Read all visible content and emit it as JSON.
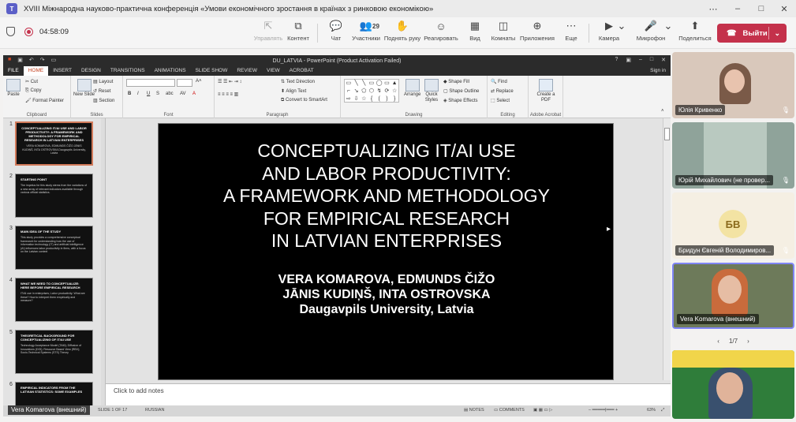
{
  "window": {
    "title": "XVIII Міжнародна науково-практична конференція «Умови економічного зростання в країнах з ринковою економікою»",
    "app_icon": "T"
  },
  "toolbar": {
    "elapsed": "04:58:09",
    "items": [
      {
        "id": "control",
        "label": "Управлять",
        "icon": "⇱",
        "disabled": true
      },
      {
        "id": "content",
        "label": "Контент",
        "icon": "⧉",
        "disabled": false
      },
      {
        "id": "chat",
        "label": "Чат",
        "icon": "💬",
        "disabled": false
      },
      {
        "id": "people",
        "label": "Участники",
        "icon": "👥",
        "disabled": false,
        "count": "29"
      },
      {
        "id": "raise",
        "label": "Поднять руку",
        "icon": "✋",
        "disabled": false
      },
      {
        "id": "react",
        "label": "Реагировать",
        "icon": "☺",
        "disabled": false
      },
      {
        "id": "view",
        "label": "Вид",
        "icon": "▦",
        "disabled": false
      },
      {
        "id": "rooms",
        "label": "Комнаты",
        "icon": "◫",
        "disabled": false
      },
      {
        "id": "apps",
        "label": "Приложения",
        "icon": "⊕",
        "disabled": false
      },
      {
        "id": "more",
        "label": "Еще",
        "icon": "⋯",
        "disabled": false
      },
      {
        "id": "camera",
        "label": "Камера",
        "icon": "▶",
        "disabled": false
      },
      {
        "id": "mic",
        "label": "Микрофон",
        "icon": "🎤",
        "disabled": false
      },
      {
        "id": "share",
        "label": "Поделиться",
        "icon": "⬆",
        "disabled": false
      }
    ],
    "leave_label": "Выйти",
    "colors": {
      "leave": "#c4314b"
    }
  },
  "powerpoint": {
    "title": "DU_LATVIA - PowerPoint (Product Activation Failed)",
    "sign_in": "Sign in",
    "tabs": [
      "FILE",
      "HOME",
      "INSERT",
      "DESIGN",
      "TRANSITIONS",
      "ANIMATIONS",
      "SLIDE SHOW",
      "REVIEW",
      "VIEW",
      "ACROBAT"
    ],
    "ribbon": {
      "clipboard": {
        "paste": "Paste",
        "cut": "Cut",
        "copy": "Copy",
        "format_painter": "Format Painter",
        "label": "Clipboard"
      },
      "slides": {
        "new_slide": "New Slide",
        "layout": "Layout",
        "reset": "Reset",
        "section": "Section",
        "label": "Slides"
      },
      "font": {
        "label": "Font"
      },
      "paragraph": {
        "text_direction": "Text Direction",
        "align_text": "Align Text",
        "smartart": "Convert to SmartArt",
        "label": "Paragraph"
      },
      "drawing": {
        "arrange": "Arrange",
        "quick_styles": "Quick Styles",
        "shape_fill": "Shape Fill",
        "shape_outline": "Shape Outline",
        "shape_effects": "Shape Effects",
        "label": "Drawing"
      },
      "editing": {
        "find": "Find",
        "replace": "Replace",
        "select": "Select",
        "label": "Editing"
      },
      "acrobat": {
        "create_pdf": "Create a PDF",
        "label": "Adobe Acrobat"
      }
    },
    "thumbnails": [
      {
        "num": "1",
        "title": "CONCEPTUALIZING IT/AI USE AND LABOR PRODUCTIVITY: A FRAMEWORK AND METHODOLOGY FOR EMPIRICAL RESEARCH IN LATVIAN ENTERPRISES",
        "body": "VERA KOMAROVA, EDMUNDS ČIŽO JĀNIS KUDIŅŠ, INTA OSTROVSKA Daugavpils University, Latvia",
        "selected": true
      },
      {
        "num": "2",
        "title": "STARTING POINT",
        "body": "The impetus for this study stems from the variations of a new array of relevant indicators available through various official statistics.",
        "selected": false
      },
      {
        "num": "3",
        "title": "MAIN IDEA OF THE STUDY",
        "body": "This study provides a comprehensive conceptual framework for understanding how the use of information technology (IT) and artificial intelligence (AI) influences labor productivity in firms, with a focus on the Latvian context",
        "selected": false
      },
      {
        "num": "4",
        "title": "WHAT WE NEED TO CONCEPTUALIZE: HERE BEFORE EMPIRICAL RESEARCH",
        "body": "IT/AI use in enterprises; Labor productivity; What are these? How to interpret them empirically and measure?",
        "selected": false
      },
      {
        "num": "5",
        "title": "THEORETICAL BACKGROUND FOR CONCEPTUALIZING OF IT/AI USE",
        "body": "Technology Acceptance Model (TAM); Diffusion of Innovations (DOI); Resource Based View (RBV); Socio-Technical Systems (STS) Theory",
        "selected": false
      },
      {
        "num": "6",
        "title": "EMPIRICAL INDICATORS FROM THE LATVIAN STATISTICS: SOME EXAMPLES",
        "body": "",
        "selected": false
      }
    ],
    "slide": {
      "title": "CONCEPTUALIZING IT/AI USE\nAND LABOR PRODUCTIVITY:\nA FRAMEWORK AND METHODOLOGY\nFOR EMPIRICAL RESEARCH\nIN LATVIAN ENTERPRISES",
      "authors_line1": "VERA KOMAROVA, EDMUNDS ČIŽO",
      "authors_line2": "JĀNIS KUDIŅŠ, INTA OSTROVSKA",
      "university": "Daugavpils University, Latvia"
    },
    "notes_placeholder": "Click to add notes",
    "status": {
      "slide_of": "SLIDE 1 OF 17",
      "language": "RUSSIAN",
      "notes": "NOTES",
      "comments": "COMMENTS",
      "zoom": "63%"
    }
  },
  "presenter_label": "Vera Komarova (внешний)",
  "participants": [
    {
      "name": "Юлія Кривенко",
      "bg": "#d9c8bb",
      "initials": ""
    },
    {
      "name": "Юрій Михайлович (не провер...",
      "bg": "#8fa39a",
      "initials": ""
    },
    {
      "name": "Бридун Євгеній Володимиров...",
      "bg": "#f5efe3",
      "initials": "БВ"
    },
    {
      "name": "Vera Komarova (внешний)",
      "bg": "#6d7a5a",
      "initials": ""
    }
  ],
  "pager": {
    "text": "1/7"
  }
}
